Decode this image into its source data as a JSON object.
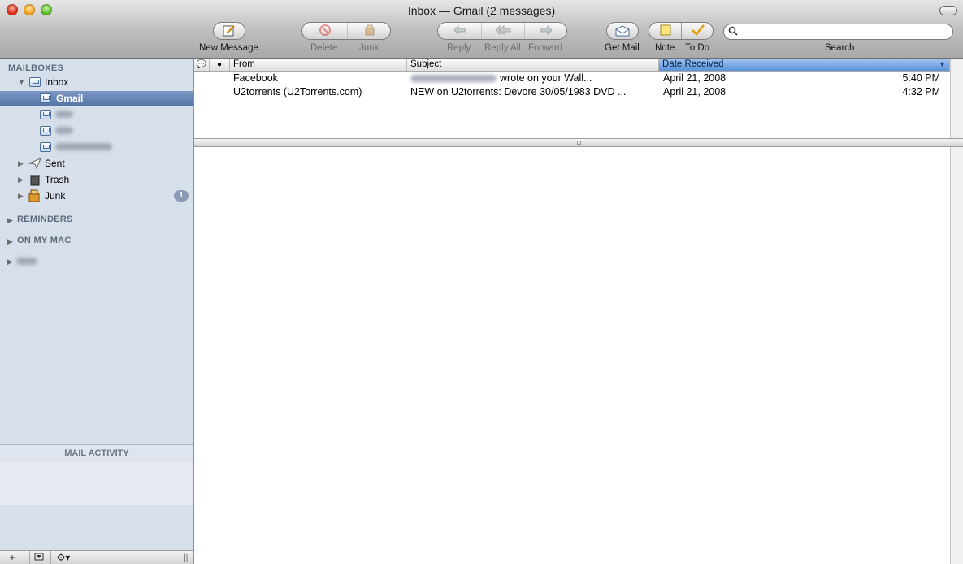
{
  "window": {
    "title": "Inbox — Gmail (2 messages)"
  },
  "toolbar": {
    "new_message": "New Message",
    "delete": "Delete",
    "junk": "Junk",
    "reply": "Reply",
    "reply_all": "Reply All",
    "forward": "Forward",
    "get_mail": "Get Mail",
    "note": "Note",
    "todo": "To Do",
    "search_label": "Search",
    "search_value": ""
  },
  "sidebar": {
    "mailboxes_header": "MAILBOXES",
    "inbox": "Inbox",
    "gmail": "Gmail",
    "sent": "Sent",
    "trash": "Trash",
    "junk": "Junk",
    "junk_count": "1",
    "reminders_header": "REMINDERS",
    "on_my_mac_header": "ON MY MAC",
    "mail_activity": "MAIL ACTIVITY"
  },
  "list": {
    "columns": {
      "from": "From",
      "subject": "Subject",
      "date": "Date Received"
    },
    "messages": [
      {
        "from": "Facebook",
        "subject": "wrote on your Wall...",
        "date": "April 21, 2008",
        "time": "5:40 PM"
      },
      {
        "from": "U2torrents (U2Torrents.com)",
        "subject": "NEW on U2torrents: Devore  30/05/1983  DVD ...",
        "date": "April 21, 2008",
        "time": "4:32 PM"
      }
    ]
  },
  "icons": {
    "new_message": "compose-icon",
    "delete": "delete-icon",
    "junk": "junk-icon",
    "reply": "reply-icon",
    "reply_all": "reply-all-icon",
    "forward": "forward-icon",
    "get_mail": "get-mail-icon",
    "note": "note-icon",
    "todo": "todo-icon"
  }
}
